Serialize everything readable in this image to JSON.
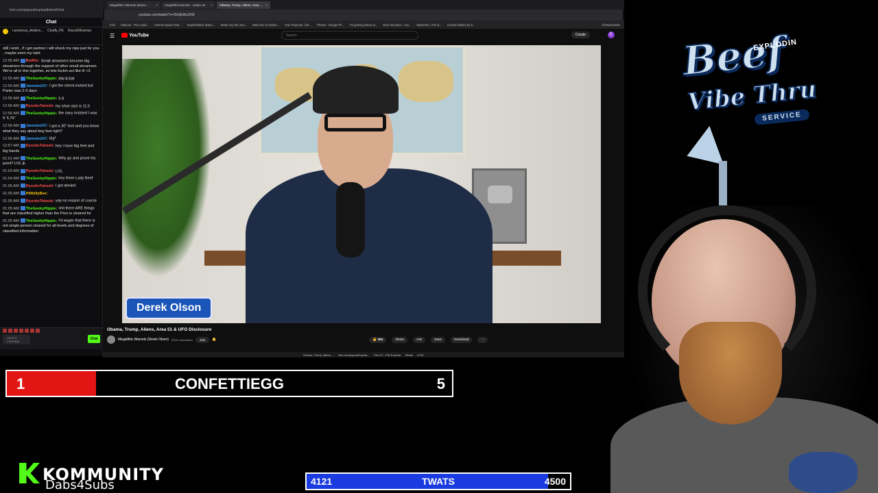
{
  "chat": {
    "url": "kick.com/popout/exploadinbeef/chat",
    "header": "Chat",
    "pinned_user": "Larserous_Anders...",
    "pinned_user2": "Chuffs_PE",
    "pinned_user3": "Disco69Games",
    "messages": [
      {
        "time": "",
        "user": "",
        "text": "still i wish , if i get partner i will shock my nips just for you , maybe even my taint",
        "color": "#e8e8e8"
      },
      {
        "time": "12:55 AM",
        "user": "BotRix:",
        "text": "Small streamers become big streamers through the support of other small streamers. We're all in this together, so lets fuckin act like it! <3",
        "color": "#ff5555"
      },
      {
        "time": "12:55 AM",
        "user": "TheGeekyHippie:",
        "text": "8W-8.5W",
        "color": "#53fc18"
      },
      {
        "time": "12:55 AM",
        "user": "Jammin247:",
        "text": "I got the check instant but Parter was 2-3 days",
        "color": "#3aa7ff"
      },
      {
        "time": "12:56 AM",
        "user": "TheGeekyHippie:",
        "text": "5 8",
        "color": "#53fc18"
      },
      {
        "time": "12:56 AM",
        "user": "RyouksTatsuki:",
        "text": "my shoe size is 11.5",
        "color": "#ff4d4d"
      },
      {
        "time": "12:56 AM",
        "user": "TheGeekyHippie:",
        "text": "the navy insisted I was 5' 5.75\"",
        "color": "#53fc18"
      },
      {
        "time": "12:56 AM",
        "user": "Jammin247:",
        "text": "I got a 30\" foot and you know what they say about beg feet right?",
        "color": "#3aa7ff"
      },
      {
        "time": "12:56 AM",
        "user": "Jammin247:",
        "text": "big*",
        "color": "#3aa7ff"
      },
      {
        "time": "12:57 AM",
        "user": "RyouksTatsuki:",
        "text": "hey i have big feet and big hands",
        "color": "#ff4d4d"
      },
      {
        "time": "01:01 AM",
        "user": "TheGeekyHippie:",
        "text": "Why go and prove his point? LOL jk",
        "color": "#53fc18"
      },
      {
        "time": "01:03 AM",
        "user": "RyouksTatsuki:",
        "text": "LOL",
        "color": "#ff4d4d"
      },
      {
        "time": "01:04 AM",
        "user": "TheGeekyHippie:",
        "text": "hey there Lady Beef",
        "color": "#53fc18"
      },
      {
        "time": "01:05 AM",
        "user": "RyouksTatsuki:",
        "text": "I got denied",
        "color": "#ff4d4d"
      },
      {
        "time": "01:05 AM",
        "user": "HillbillyBee:",
        "text": "",
        "color": "#f5c400"
      },
      {
        "time": "01:05 AM",
        "user": "RyouksTatsuki:",
        "text": "yep no reason of course",
        "color": "#ff4d4d"
      },
      {
        "time": "01:05 AM",
        "user": "TheGeekyHippie:",
        "text": "shit there ARE things that are classified higher than the Pres is cleared for",
        "color": "#53fc18"
      },
      {
        "time": "01:05 AM",
        "user": "TheGeekyHippie:",
        "text": "I'd wager that there is not single person cleared for all levels and degrees of classified information",
        "color": "#53fc18"
      }
    ],
    "input_placeholder": "Send a message",
    "send_label": "Chat"
  },
  "browser": {
    "tabs": [
      "Megalithic Marvels (Exten...",
      "megalithicmarvels - Listen on",
      "Obama, Trump, Aliens, Area ..."
    ],
    "url": "youtube.com/watch?v=2b9jk3i6z2N0",
    "bookmarks": [
      "Kick",
      "Stakuun - The Leadi...",
      "Internet Speed Test...",
      "ExplodinBeef Stats |...",
      "Make Any Mic Sou...",
      "Welcome to Okaho...",
      "Your Projector | cbt...",
      "Photos - Google Ph...",
      "Fb gaming issues w...",
      "KICK Bounties - exe...",
      "Myintents | The la...",
      "Limited Gallery by b..."
    ],
    "bookmarks_all": "All Bookmarks",
    "yt_logo": "YouTube",
    "search_placeholder": "Search",
    "create_label": "Create",
    "avatar_letter": "E",
    "video_lower_third": "Derek Olson",
    "video_title": "Obama, Trump, Aliens, Area 51 & UFO Disclosure",
    "channel_name": "Megalithic Marvels (Derek Olson)",
    "channel_subs": "530K subscribers",
    "join_label": "Join",
    "likes": "354",
    "share_label": "Share",
    "ask_label": "Ask",
    "save_label": "Save",
    "download_label": "Download",
    "taskbar": [
      "Obama, Trump, Aliens, ...",
      "kick.com/popout/exploa...",
      "This PC - File Explorer",
      "Steam",
      "ICUE"
    ]
  },
  "logo": {
    "top": "EXPLODIN",
    "main": "Beef",
    "vibe": "Vibe Thru",
    "service": "SERVICE"
  },
  "goals": {
    "top": {
      "left": "1",
      "label": "CONFETTIEGG",
      "right": "5",
      "progress": 0.2,
      "color": "#e31414"
    },
    "bottom": {
      "left": "4121",
      "label": "TWATS",
      "right": "4500",
      "progress": 0.916,
      "color": "#1a3be0"
    }
  },
  "kommunity": {
    "word": "KOMMUNITY",
    "sub": "Dabs4Subs",
    "color": "#53fc18"
  }
}
